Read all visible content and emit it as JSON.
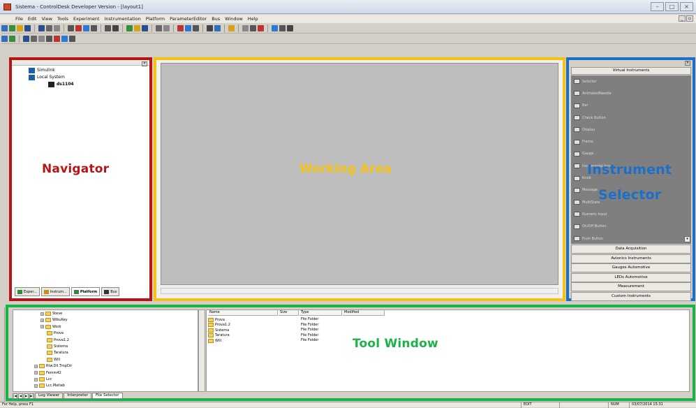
{
  "window": {
    "title": "Sistema - ControlDesk Developer Version - [layout1]"
  },
  "menu": [
    "File",
    "Edit",
    "View",
    "Tools",
    "Experiment",
    "Instrumentation",
    "Platform",
    "ParameterEditor",
    "Bus",
    "Window",
    "Help"
  ],
  "annotations": {
    "navigator": "Navigator",
    "working_area": "Working Area",
    "instrument_selector_line1": "Instrument",
    "instrument_selector_line2": "Selector",
    "tool_window": "Tool Window",
    "colors": {
      "navigator": "#b71515",
      "working_area": "#f4c212",
      "instrument_selector": "#1a6fc9",
      "tool_window": "#1bb247"
    }
  },
  "navigator": {
    "tree": [
      {
        "label": "Simulink",
        "icon": "simulink-icon"
      },
      {
        "label": "Local System",
        "icon": "computer-icon"
      },
      {
        "label": "ds1104",
        "icon": "board-icon"
      }
    ],
    "tabs": [
      {
        "label": "Exper...",
        "icon": "experiment-icon",
        "active": false
      },
      {
        "label": "Instrum...",
        "icon": "instrument-icon",
        "active": false
      },
      {
        "label": "Platform",
        "icon": "platform-icon",
        "active": true
      },
      {
        "label": "Bus",
        "icon": "bus-icon",
        "active": false
      }
    ]
  },
  "instruments": {
    "header": "Virtual Instruments",
    "items": [
      {
        "label": "Selector",
        "icon": "pointer-icon"
      },
      {
        "label": "AnimatedNeedle",
        "icon": "needle-icon"
      },
      {
        "label": "Bar",
        "icon": "bar-icon"
      },
      {
        "label": "Check Button",
        "icon": "checkbox-icon"
      },
      {
        "label": "Display",
        "icon": "display-icon"
      },
      {
        "label": "Frame",
        "icon": "frame-icon"
      },
      {
        "label": "Gauge",
        "icon": "gauge-icon"
      },
      {
        "label": "Incremental Input",
        "icon": "increment-icon"
      },
      {
        "label": "Knob",
        "icon": "knob-icon"
      },
      {
        "label": "Message",
        "icon": "message-icon"
      },
      {
        "label": "MultiState",
        "icon": "multistate-icon"
      },
      {
        "label": "Numeric Input",
        "icon": "numeric-icon"
      },
      {
        "label": "On/Off Button",
        "icon": "onoff-icon"
      },
      {
        "label": "Push Button",
        "icon": "pushbutton-icon"
      }
    ],
    "categories": [
      "Data Acquisition",
      "Avionics Instruments",
      "Gauges Automotive",
      "LEDs Automotive",
      "Measurement",
      "Custom Instruments"
    ]
  },
  "file_tree": [
    {
      "label": "Steve",
      "indent": 1
    },
    {
      "label": "WibuKey",
      "indent": 1
    },
    {
      "label": "Work",
      "indent": 1
    },
    {
      "label": "Prova",
      "indent": 2
    },
    {
      "label": "Prova1.2",
      "indent": 2
    },
    {
      "label": "Sistema",
      "indent": 2
    },
    {
      "label": "Taratura",
      "indent": 2
    },
    {
      "label": "Will",
      "indent": 2
    },
    {
      "label": "Rtw.Dll.TmpDir",
      "indent": 0
    },
    {
      "label": "Femm42",
      "indent": 0
    },
    {
      "label": "Lcc",
      "indent": 0
    },
    {
      "label": "Lcc.Matlab",
      "indent": 0
    }
  ],
  "file_list": {
    "columns": [
      "Name",
      "Size",
      "Type",
      "Modified"
    ],
    "rows": [
      {
        "name": "Prova",
        "type": "File Folder"
      },
      {
        "name": "Prova1.2",
        "type": "File Folder"
      },
      {
        "name": "Sistema",
        "type": "File Folder"
      },
      {
        "name": "Taratura",
        "type": "File Folder"
      },
      {
        "name": "Will",
        "type": "File Folder"
      }
    ]
  },
  "tool_tabs": [
    "Log Viewer",
    "Interpreter",
    "File Selector"
  ],
  "status": {
    "help": "For Help, press F1",
    "edit": "EDIT",
    "num": "NUM",
    "datetime": "03/07/2014  15:31"
  }
}
